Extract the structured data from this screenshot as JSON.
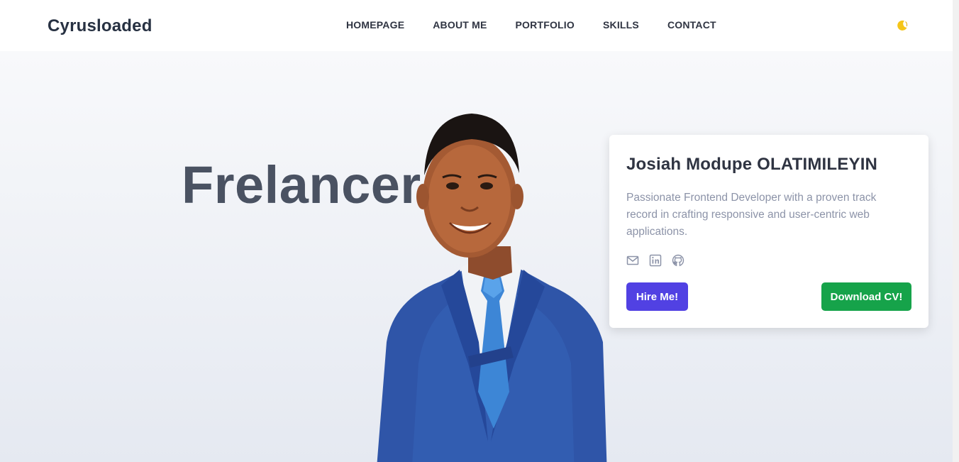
{
  "brand": "Cyrusloaded",
  "nav": {
    "items": [
      {
        "label": "HOMEPAGE"
      },
      {
        "label": "ABOUT ME"
      },
      {
        "label": "PORTFOLIO"
      },
      {
        "label": "SKILLS"
      },
      {
        "label": "CONTACT"
      }
    ],
    "theme_icon": "moon-icon"
  },
  "hero": {
    "headline": "Frelancer",
    "portrait": "person-portrait"
  },
  "card": {
    "name": "Josiah Modupe OLATIMILEYIN",
    "description": "Passionate Frontend Developer with a proven track record in crafting responsive and user-centric web applications.",
    "socials": [
      "mail-icon",
      "linkedin-icon",
      "github-icon"
    ],
    "hire_label": "Hire Me!",
    "cv_label": "Download CV!"
  },
  "colors": {
    "accent_purple": "#5141e3",
    "accent_green": "#16a34a",
    "text_dark": "#2f3442",
    "text_muted": "#8c93a8",
    "moon": "#f5c518"
  }
}
